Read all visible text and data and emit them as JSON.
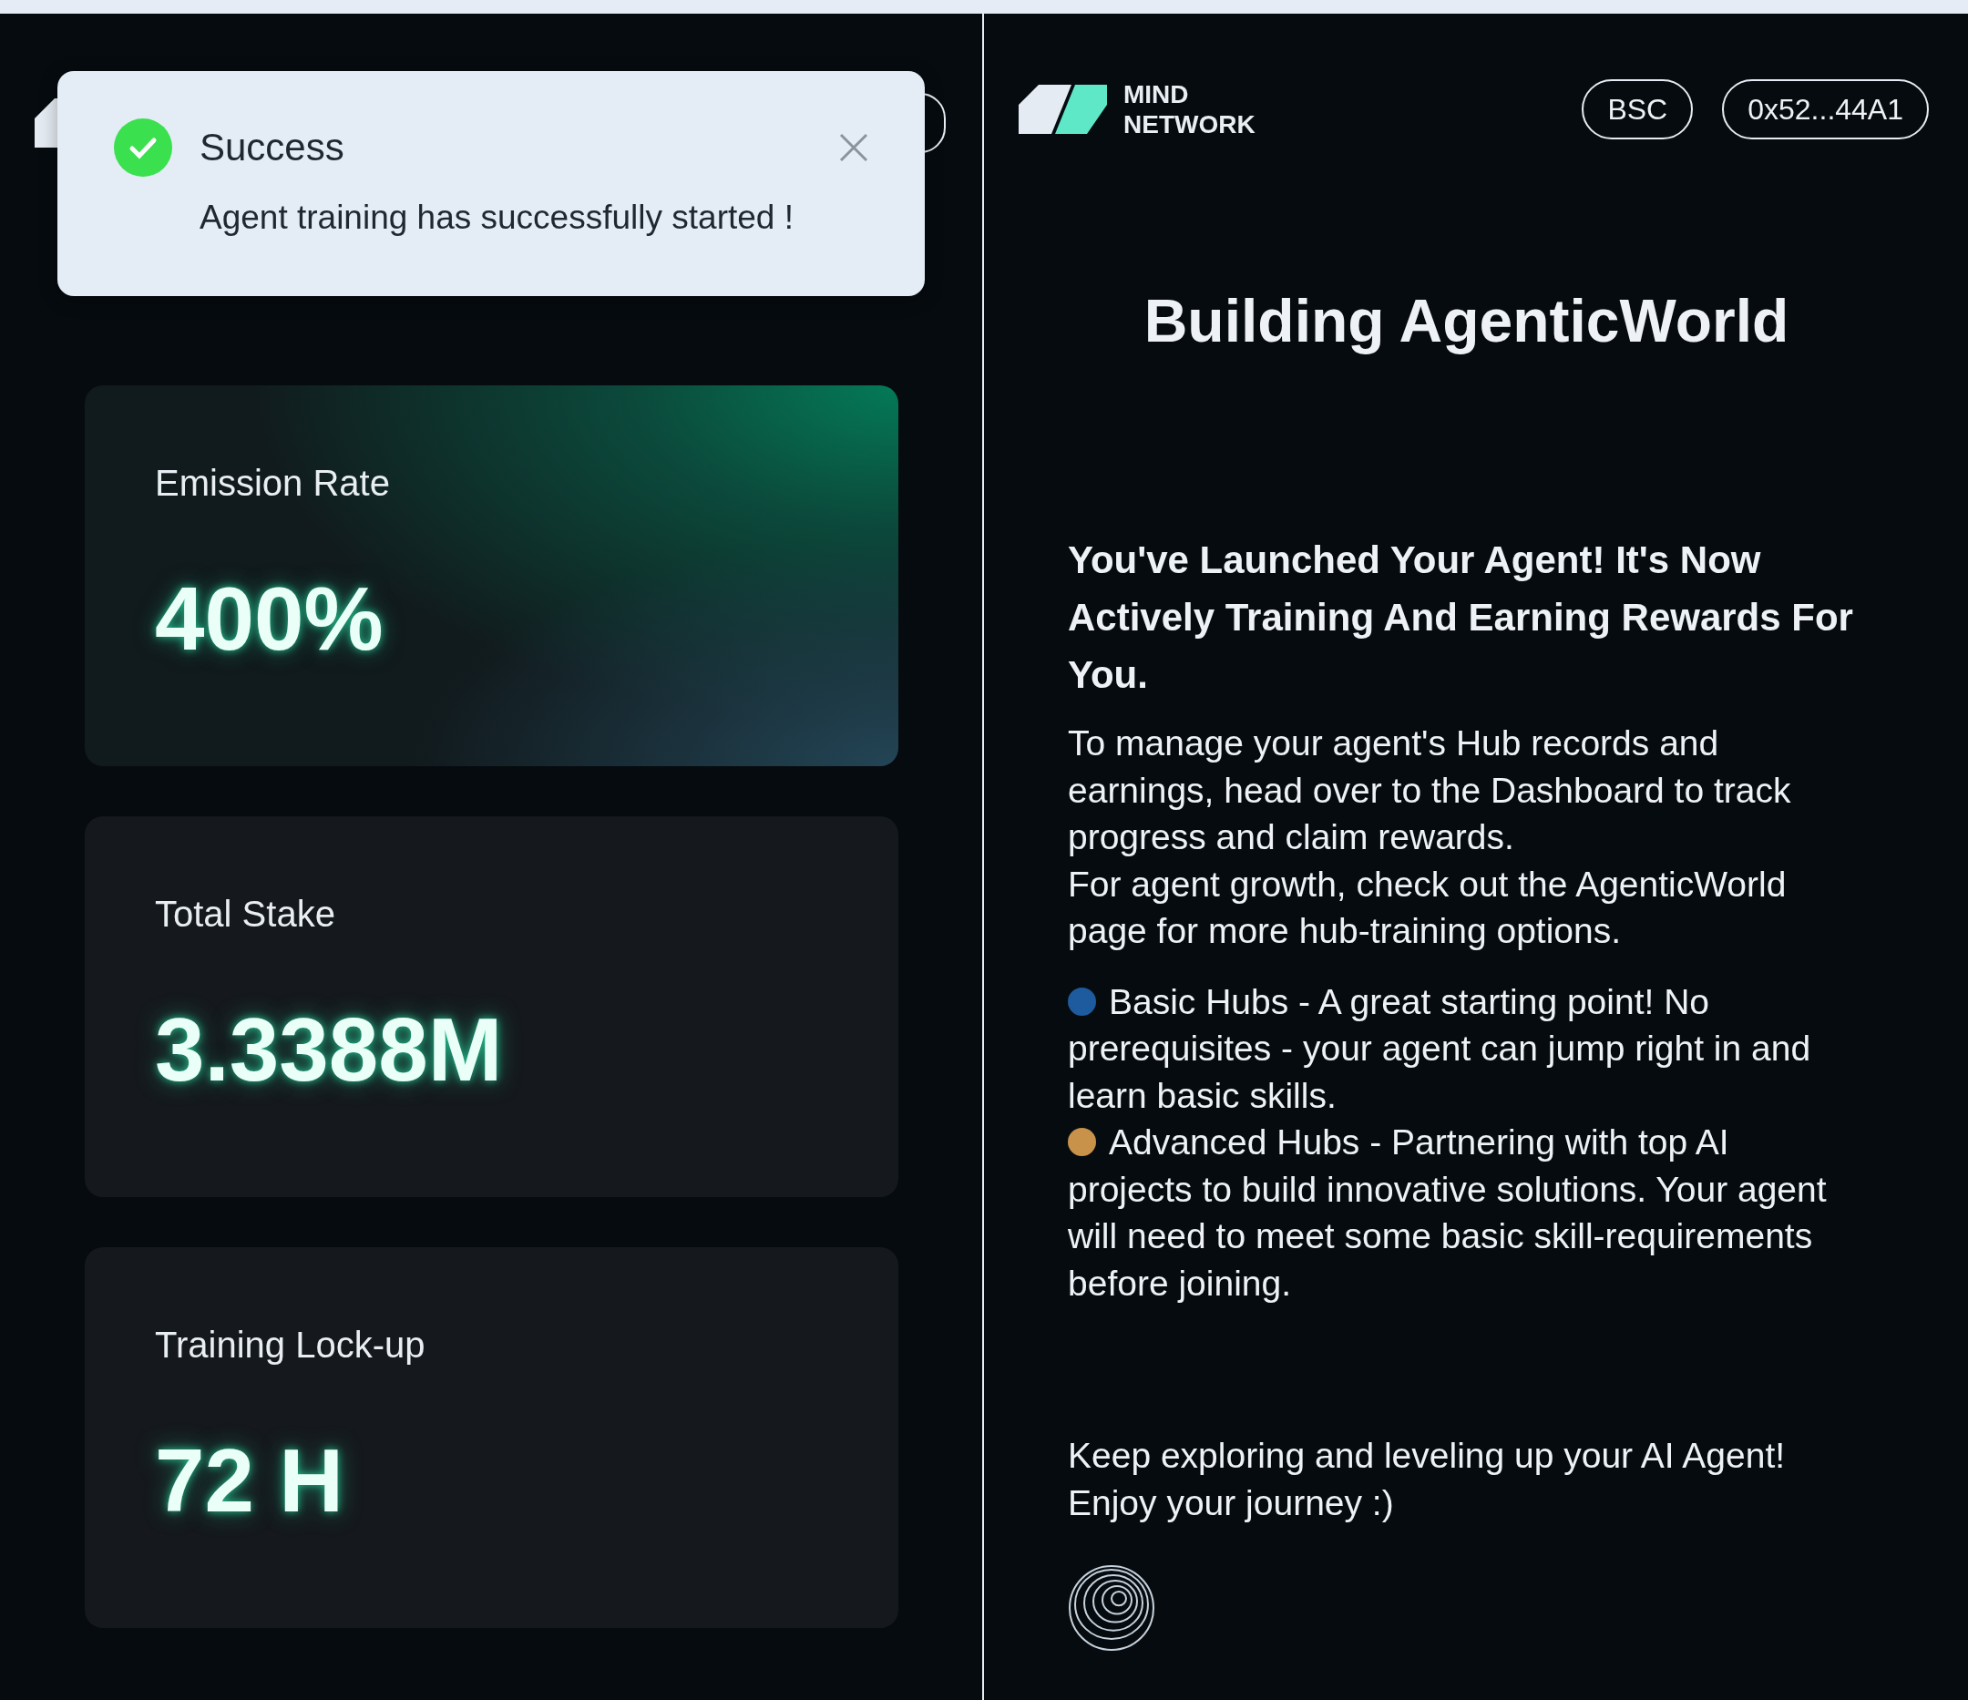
{
  "toast": {
    "title": "Success",
    "message": "Agent training has successfully started !"
  },
  "stats": [
    {
      "label": "Emission Rate",
      "value": "400%",
      "highlighted": true
    },
    {
      "label": "Total Stake",
      "value": "3.3388M",
      "highlighted": false
    },
    {
      "label": "Training Lock-up",
      "value": "72 H",
      "highlighted": false
    }
  ],
  "header": {
    "brand_lines": [
      "MIND",
      "NETWORK"
    ],
    "network": "BSC",
    "address": "0x52...44A1"
  },
  "title": "Building AgenticWorld",
  "heading": "You've Launched Your Agent! It's Now Actively Training And Earning Rewards For You.",
  "paragraphs": [
    "To manage your agent's Hub records and earnings, head over to the Dashboard to track progress and claim rewards.",
    "For agent growth, check out the AgenticWorld page for more hub-training options."
  ],
  "hubs": [
    {
      "text": "Basic Hubs - A great starting point! No prerequisites - your agent can jump right in and learn basic skills.",
      "color": "#1d5a9e"
    },
    {
      "text": "Advanced Hubs - Partnering with top AI projects to build innovative solutions. Your agent will need to meet some basic skill-requirements before joining.",
      "color": "#c8924a"
    }
  ],
  "closing": [
    "Keep exploring and leveling up your AI Agent!",
    "Enjoy your journey :)"
  ]
}
